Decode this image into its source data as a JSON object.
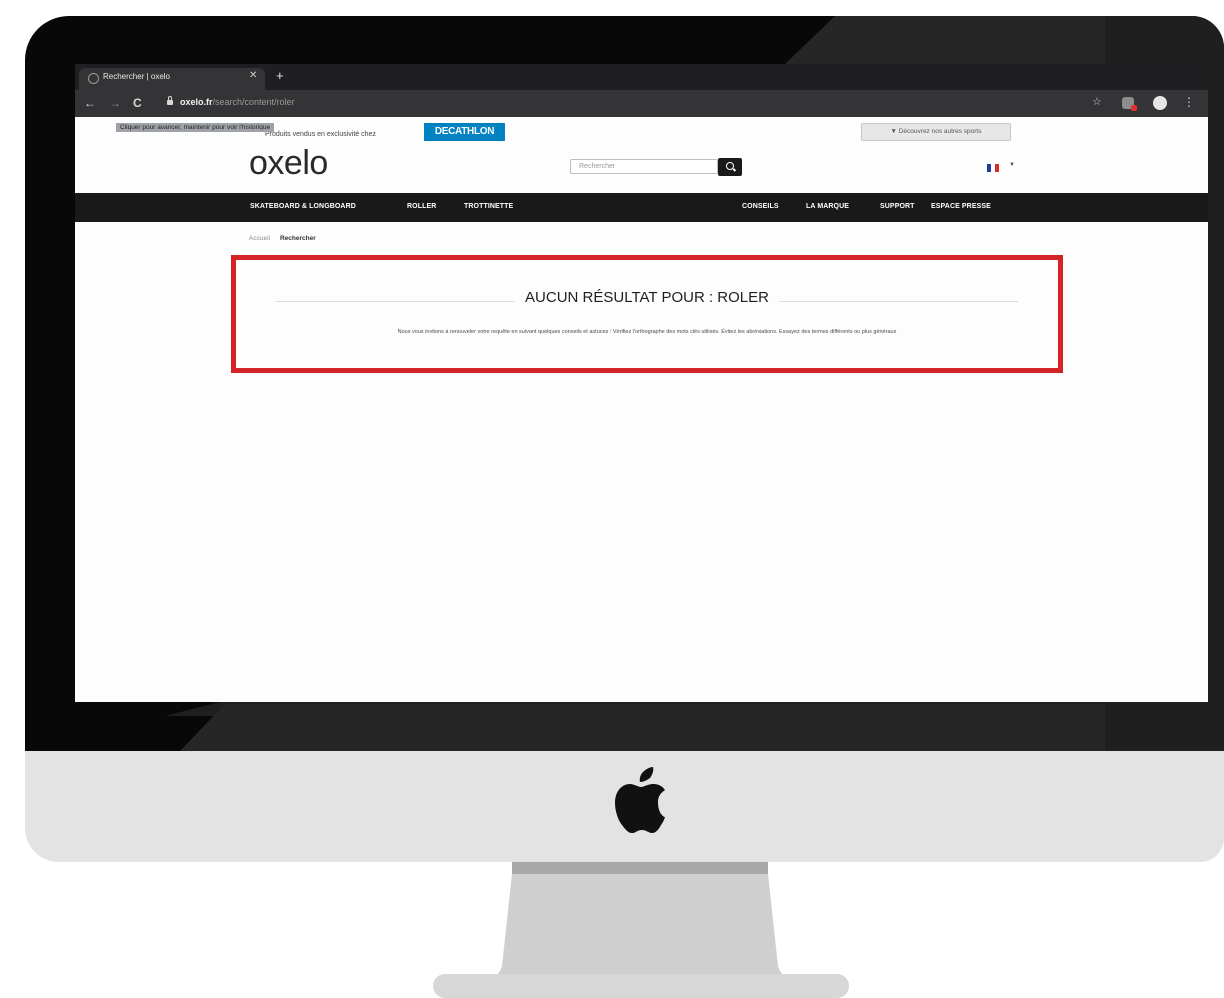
{
  "browser": {
    "tab_title": "Rechercher | oxelo",
    "url_host": "oxelo.fr",
    "url_path": "/search/content/roler",
    "tooltip": "Cliquer pour avancer, maintenir pour voir l'historique"
  },
  "site": {
    "topline": "Produits vendus en exclusivité chez",
    "partner_brand": "DECATHLON",
    "other_sports_button": "▼ Découvrez nos autres sports",
    "logo": "oxelo",
    "search_placeholder": "Rechercher",
    "nav_left": [
      "SKATEBOARD & LONGBOARD",
      "ROLLER",
      "TROTTINETTE"
    ],
    "nav_right": [
      "CONSEILS",
      "LA MARQUE",
      "SUPPORT",
      "ESPACE PRESSE"
    ],
    "breadcrumb": [
      "Accueil",
      "Rechercher"
    ]
  },
  "results": {
    "heading": "AUCUN RÉSULTAT POUR : ROLER",
    "advice": "Nous vous invitons à renouveler votre requête en suivant quelques conseils et astuces : Vérifiez l'orthographe des mots clés utilisés. Évitez les abréviations. Essayez des termes différents ou plus généraux"
  },
  "colors": {
    "highlight": "#d42428",
    "decathlon_blue": "#0082c3",
    "navbar": "#191919"
  },
  "icons": [
    "back-arrow-icon",
    "forward-arrow-icon",
    "reload-icon",
    "lock-icon",
    "star-icon",
    "extension-icon",
    "profile-icon",
    "menu-icon",
    "search-icon",
    "french-flag-icon",
    "apple-logo-icon"
  ]
}
